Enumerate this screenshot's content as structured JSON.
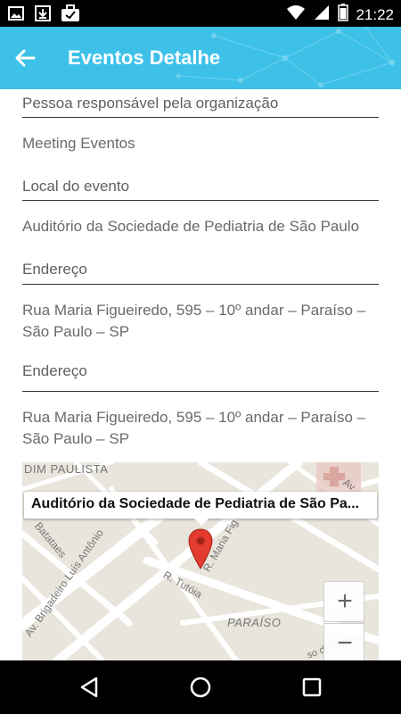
{
  "status_bar": {
    "time": "21:22",
    "left_icons": [
      "image-icon",
      "download-icon",
      "briefcase-check-icon"
    ],
    "right_icons": [
      "wifi-icon",
      "signal-icon",
      "battery-icon"
    ]
  },
  "app_bar": {
    "title": "Eventos Detalhe",
    "back_icon": "arrow-left-icon",
    "color": "#3ec1e8"
  },
  "fields": [
    {
      "label": "Pessoa responsável pela organização",
      "value": "Meeting Eventos"
    },
    {
      "label": "Local do evento",
      "value": "Auditório da Sociedade de Pediatria de São Paulo"
    },
    {
      "label": "Endereço",
      "value_line1": "Rua Maria Figueiredo, 595 – 10º andar – Paraíso –",
      "value_line2": "São Paulo – SP"
    },
    {
      "label": "Endereço",
      "value_line1": "Rua Maria Figueiredo, 595 – 10º andar – Paraíso –",
      "value_line2": "São Paulo – SP"
    }
  ],
  "map": {
    "tooltip": "Auditório da Sociedade de Pediatria de São Pa...",
    "zoom_in": "+",
    "zoom_out": "−",
    "streets": {
      "jardim": "DIM PAULISTA",
      "batataes": "Batataes",
      "brigadeiro": "Av. Brigadeiro Luís Antônio",
      "maria_fig": "R. Maria Fig",
      "tutoia": "R. Tutóia",
      "paraiso": "PARAÍSO",
      "av_top": "Av",
      "bottom_right": "so de Freitas"
    },
    "marker_icon": "map-pin-icon"
  },
  "nav_bar": {
    "icons": [
      "back-triangle-icon",
      "home-circle-icon",
      "recents-square-icon"
    ]
  }
}
